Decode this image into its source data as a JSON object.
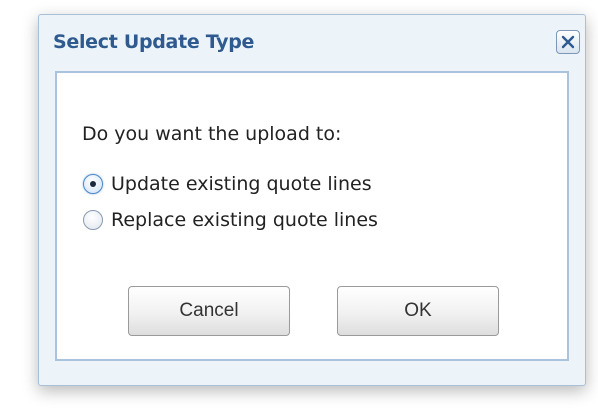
{
  "dialog": {
    "title": "Select Update Type",
    "close_icon": "close-icon",
    "question": "Do you want the upload to:",
    "options": [
      {
        "label": "Update existing quote lines",
        "checked": true
      },
      {
        "label": "Replace existing quote lines",
        "checked": false
      }
    ],
    "buttons": {
      "cancel": "Cancel",
      "ok": "OK"
    }
  },
  "colors": {
    "title": "#2e5a8f",
    "frame_border": "#a9bfd6",
    "content_border": "#a9c2dd",
    "radio_selected": "#4f87c7"
  }
}
